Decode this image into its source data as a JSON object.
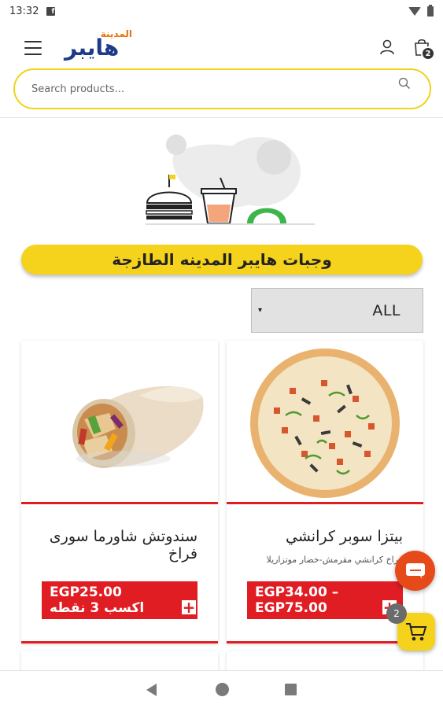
{
  "status_bar": {
    "time": "13:32",
    "fb_icon": "f"
  },
  "header": {
    "logo_sub": "المدينة",
    "logo_main": "هايبر",
    "cart_count": "2"
  },
  "search": {
    "placeholder": "Search products..."
  },
  "banner": {
    "title": "وجبات هايبر المدينه الطازجة"
  },
  "filter": {
    "selected": "ALL"
  },
  "products": [
    {
      "title": "سندوتش شاورما سورى فراخ",
      "description": "",
      "price": "EGP25.00",
      "points": "اكسب 3 نقطه"
    },
    {
      "title": "بيتزا سوبر كرانشي",
      "description": "فراخ كرانشي مقرمش-خضار موتزاريلا",
      "price": "EGP34.00 –",
      "price2": "EGP75.00"
    }
  ],
  "floating_cart": {
    "count": "2"
  },
  "colors": {
    "accent_yellow": "#f5d21c",
    "accent_red": "#e11d24",
    "logo_blue": "#1e3a8a",
    "chat_orange": "#e64a19"
  },
  "icons": [
    "menu-icon",
    "user-icon",
    "bag-icon",
    "search-icon",
    "chat-icon",
    "cart-icon",
    "back-icon",
    "home-icon",
    "recents-icon"
  ]
}
